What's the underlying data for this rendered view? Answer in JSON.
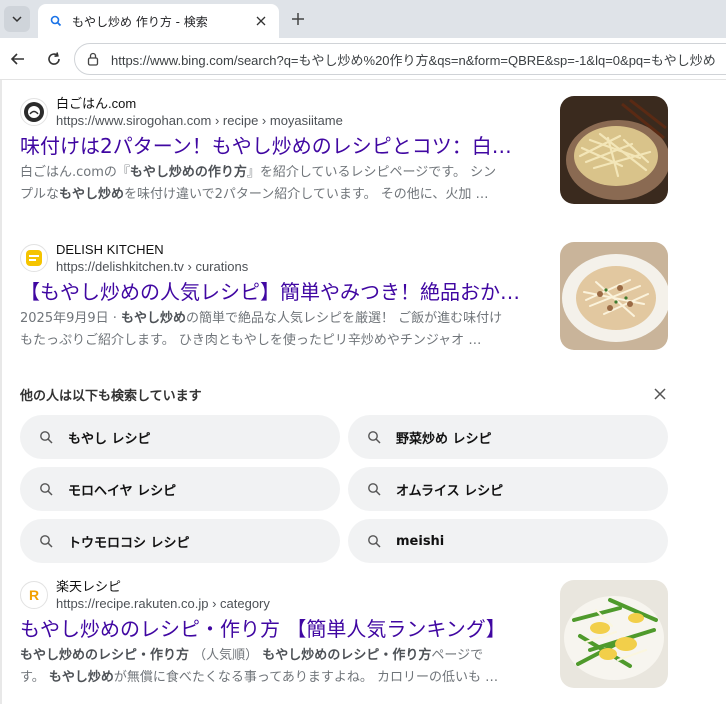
{
  "browser": {
    "tab_title": "もやし炒め 作り方 - 検索",
    "url": "https://www.bing.com/search?q=もやし炒め%20作り方&qs=n&form=QBRE&sp=-1&lq=0&pq=もやし炒め"
  },
  "results": [
    {
      "site_name": "白ごはん.com",
      "site_url": "https://www.sirogohan.com › recipe › moyasiitame",
      "title": "味付けは2パターン！もやし炒めのレシピとコツ：白…",
      "snippet_line1_a": "白ごはん.comの『",
      "snippet_line1_b": "もやし炒めの作り方",
      "snippet_line1_c": "』を紹介しているレシピページです。 シン",
      "snippet_line2_a": "プルな",
      "snippet_line2_b": "もやし炒め",
      "snippet_line2_c": "を味付け違いで2パターン紹介しています。 その他に、火加 …"
    },
    {
      "site_name": "DELISH KITCHEN",
      "site_url": "https://delishkitchen.tv › curations",
      "title": "【もやし炒めの人気レシピ】簡単やみつき！絶品おか…",
      "snippet_line1_a": "2025年9月9日 · ",
      "snippet_line1_b": "もやし炒め",
      "snippet_line1_c": "の簡単で絶品な人気レシピを厳選！ ご飯が進む味付け",
      "snippet_line2_a": "もたっぷりご紹介します。 ひき肉ともやしを使ったピリ辛炒めやチンジャオ …",
      "snippet_line2_b": "",
      "snippet_line2_c": ""
    },
    {
      "site_name": "楽天レシピ",
      "site_url": "https://recipe.rakuten.co.jp › category",
      "title": "もやし炒めのレシピ・作り方 【簡単人気ランキング】",
      "snippet_line1_a": "",
      "snippet_line1_b": "もやし炒め",
      "snippet_line1_c": "のレシピ・作り方",
      "snippet_line1_d": " （人気順） ",
      "snippet_line1_e": "もやし炒め",
      "snippet_line1_f": "のレシピ・作り方",
      "snippet_line1_g": "ページで",
      "snippet_line2_a": "す。 ",
      "snippet_line2_b": "もやし炒め",
      "snippet_line2_c": "が無償に食べたくなる事ってありますよね。 カロリーの低いも …"
    }
  ],
  "related": {
    "title": "他の人は以下も検索しています",
    "items": [
      "もやし レシピ",
      "野菜炒め レシピ",
      "モロヘイヤ レシピ",
      "オムライス レシピ",
      "トウモロコシ レシピ",
      "meishi"
    ]
  },
  "colors": {
    "link": "#4007a2",
    "chip_bg": "#f1f2f3"
  }
}
